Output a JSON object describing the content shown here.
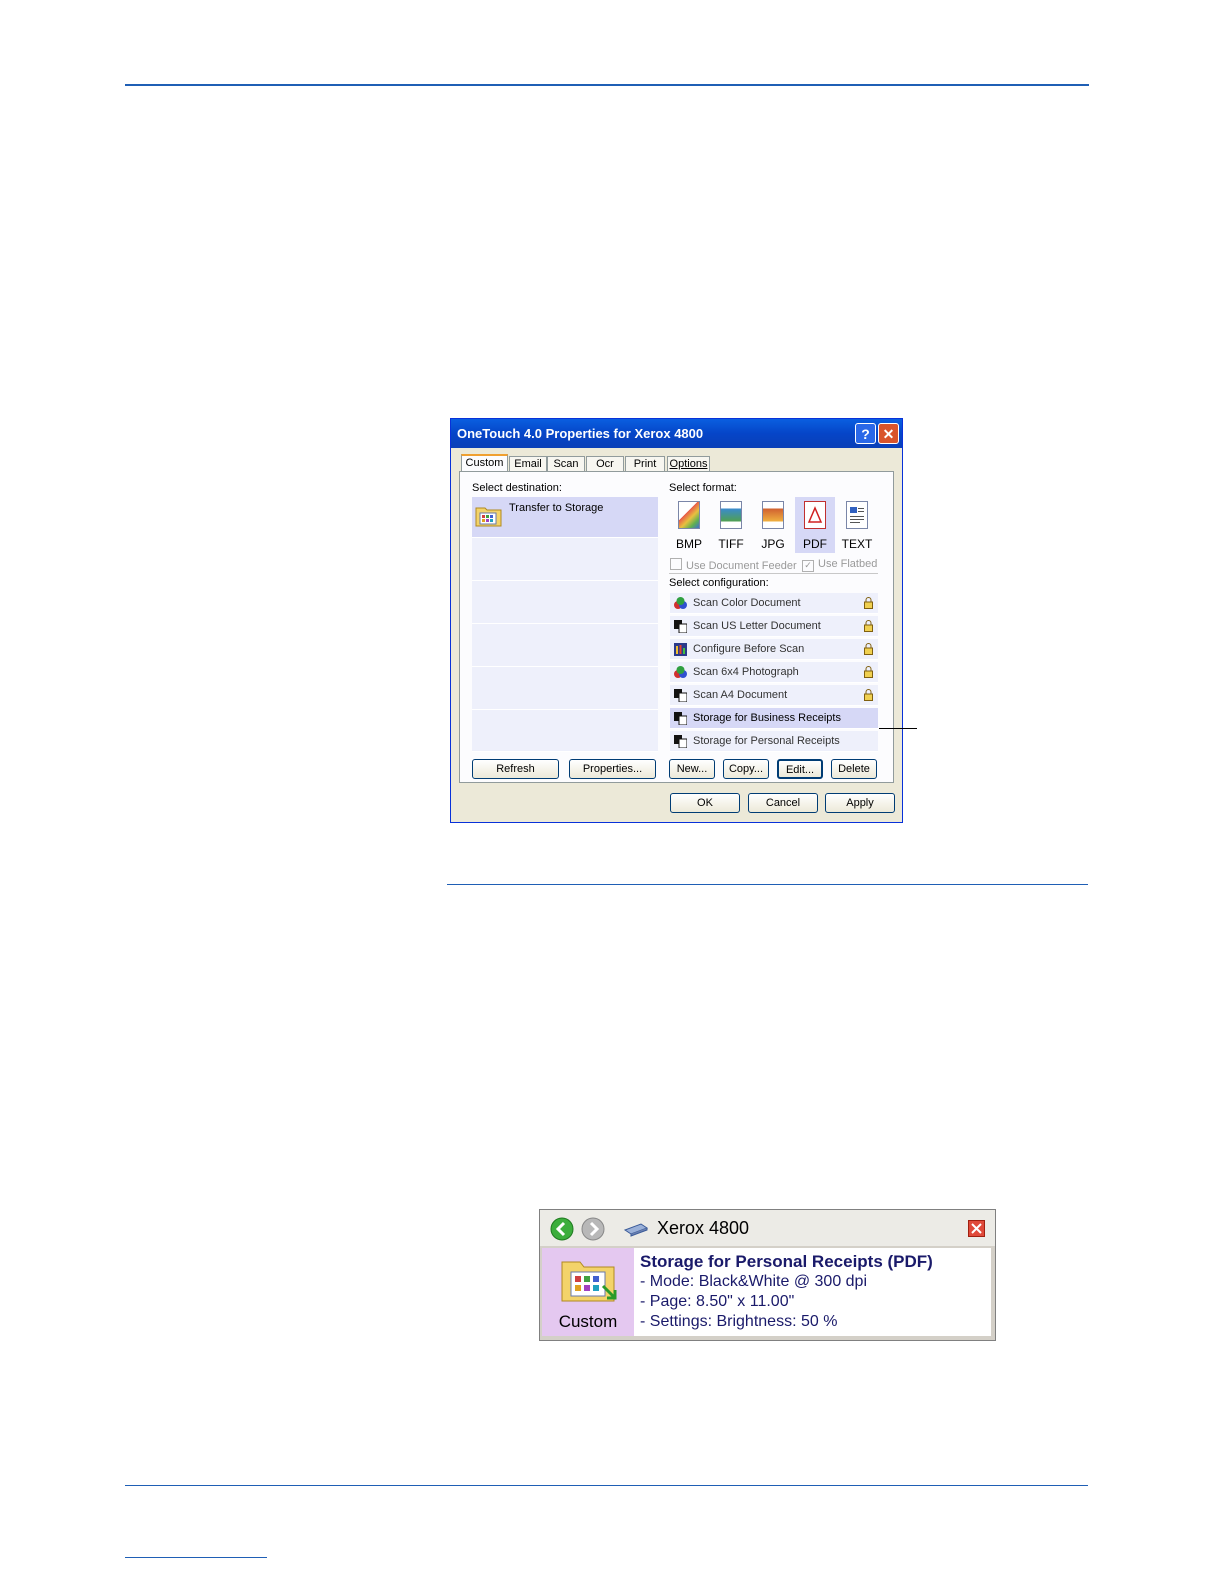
{
  "dialog": {
    "title": "OneTouch 4.0 Properties for Xerox 4800",
    "help_glyph": "?",
    "close_glyph": "✕",
    "tabs": [
      "Custom",
      "Email",
      "Scan",
      "Ocr",
      "Print",
      "Options"
    ],
    "select_destination_label": "Select destination:",
    "destinations": [
      "Transfer to Storage"
    ],
    "select_format_label": "Select format:",
    "formats": [
      "BMP",
      "TIFF",
      "JPG",
      "PDF",
      "TEXT"
    ],
    "selected_format": "PDF",
    "use_document_feeder": "Use Document Feeder",
    "use_flatbed": "Use Flatbed",
    "select_configuration_label": "Select configuration:",
    "configurations": [
      "Scan Color Document",
      "Scan US Letter Document",
      "Configure Before Scan",
      "Scan 6x4 Photograph",
      "Scan A4 Document",
      "Storage for Business Receipts",
      "Storage for Personal Receipts"
    ],
    "buttons": {
      "refresh": "Refresh",
      "properties": "Properties...",
      "new": "New...",
      "copy": "Copy...",
      "edit": "Edit...",
      "delete": "Delete",
      "ok": "OK",
      "cancel": "Cancel",
      "apply": "Apply"
    }
  },
  "status_panel": {
    "device": "Xerox 4800",
    "icon_label": "Custom",
    "title": "Storage for Personal Receipts (PDF)",
    "mode": "- Mode: Black&White @ 300 dpi",
    "page": "- Page:  8.50\" x 11.00\"",
    "settings": "- Settings: Brightness: 50 %"
  },
  "colors": {
    "rule": "#1f5fb5",
    "selection": "#d6d8f6",
    "title_bar": "#0545c8"
  }
}
